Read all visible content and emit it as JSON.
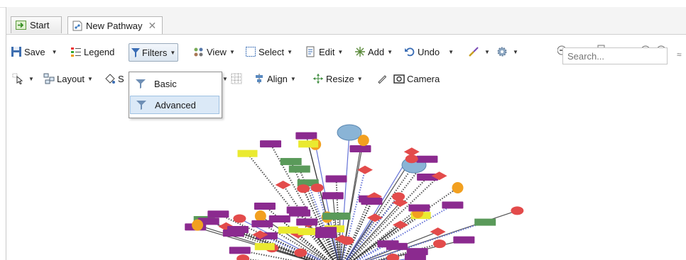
{
  "tabs": [
    {
      "label": "Start",
      "icon": "start-arrow-icon"
    },
    {
      "label": "New Pathway",
      "icon": "pathway-icon",
      "close": "✕"
    }
  ],
  "toolbar_row1": {
    "save": "Save",
    "legend": "Legend",
    "filters": "Filters",
    "view": "View",
    "select": "Select",
    "edit": "Edit",
    "add": "Add",
    "undo": "Undo"
  },
  "toolbar_row2": {
    "layout": "Layout",
    "style_partial": "S",
    "align": "Align",
    "resize": "Resize",
    "camera": "Camera"
  },
  "search": {
    "placeholder": "Search..."
  },
  "filters_menu": {
    "items": [
      "Basic",
      "Advanced"
    ],
    "highlighted": "Advanced"
  },
  "colors": {
    "node_purple": "#8b2a8f",
    "node_red": "#e34b4b",
    "node_orange": "#f2a020",
    "node_green": "#5a9a5a",
    "node_yellow": "#eaea30",
    "node_blue": "#8ab4d6",
    "highlight": "#dbe9f7"
  }
}
